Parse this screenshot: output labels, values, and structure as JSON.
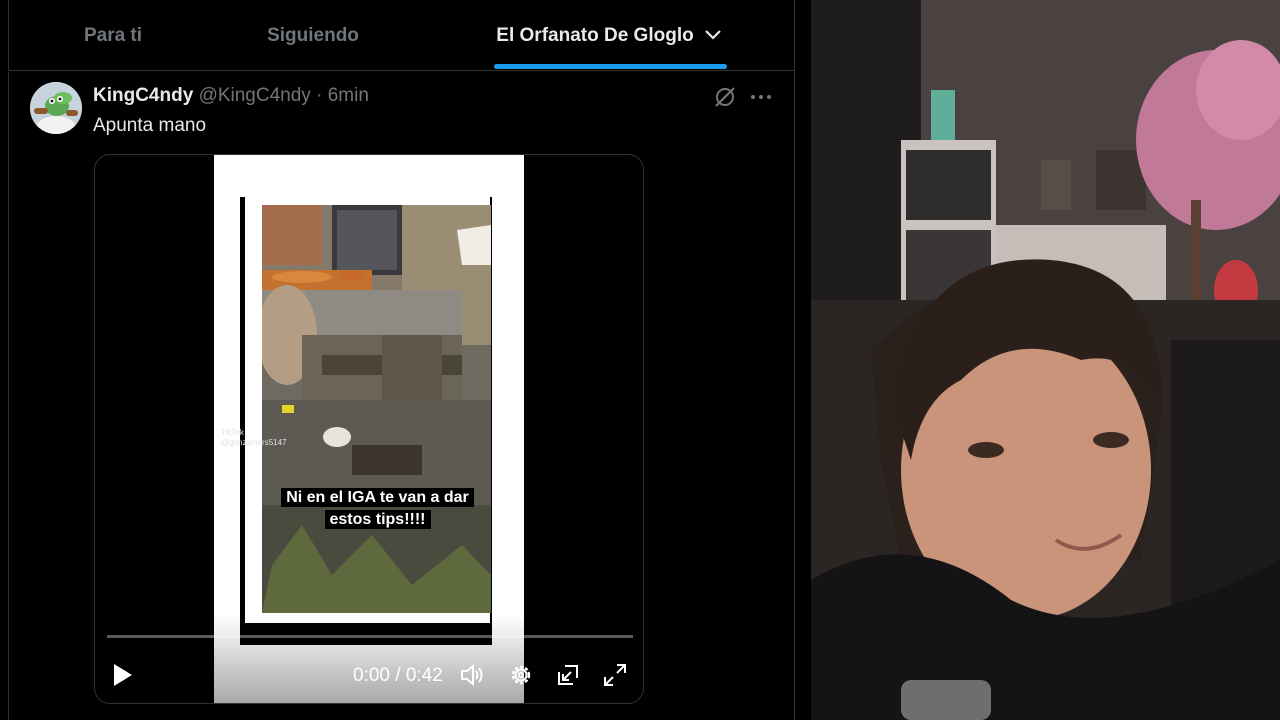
{
  "tabs": [
    {
      "label": "Para ti",
      "active": false
    },
    {
      "label": "Siguiendo",
      "active": false
    },
    {
      "label": "El Orfanato De Gloglo",
      "active": true
    }
  ],
  "post": {
    "display_name": "KingC4ndy",
    "handle": "@KingC4ndy",
    "separator": "·",
    "time": "6min",
    "text": "Apunta mano"
  },
  "video": {
    "caption_line1": "Ni en el IGA te van a dar",
    "caption_line2": "estos tips!!!!",
    "watermark_brand": "TikTok",
    "watermark_user": "@gonzamers5147",
    "current_time": "0:00",
    "duration": "0:42",
    "time_separator": "/",
    "progress": 0.0
  },
  "colors": {
    "accent": "#1d9bf0",
    "background": "#000000",
    "muted_text": "#71767b",
    "primary_text": "#e7e9ea"
  },
  "icons": [
    "chevron-down-icon",
    "grok-icon",
    "more-icon",
    "play-icon",
    "volume-icon",
    "settings-icon",
    "pip-icon",
    "fullscreen-icon"
  ]
}
